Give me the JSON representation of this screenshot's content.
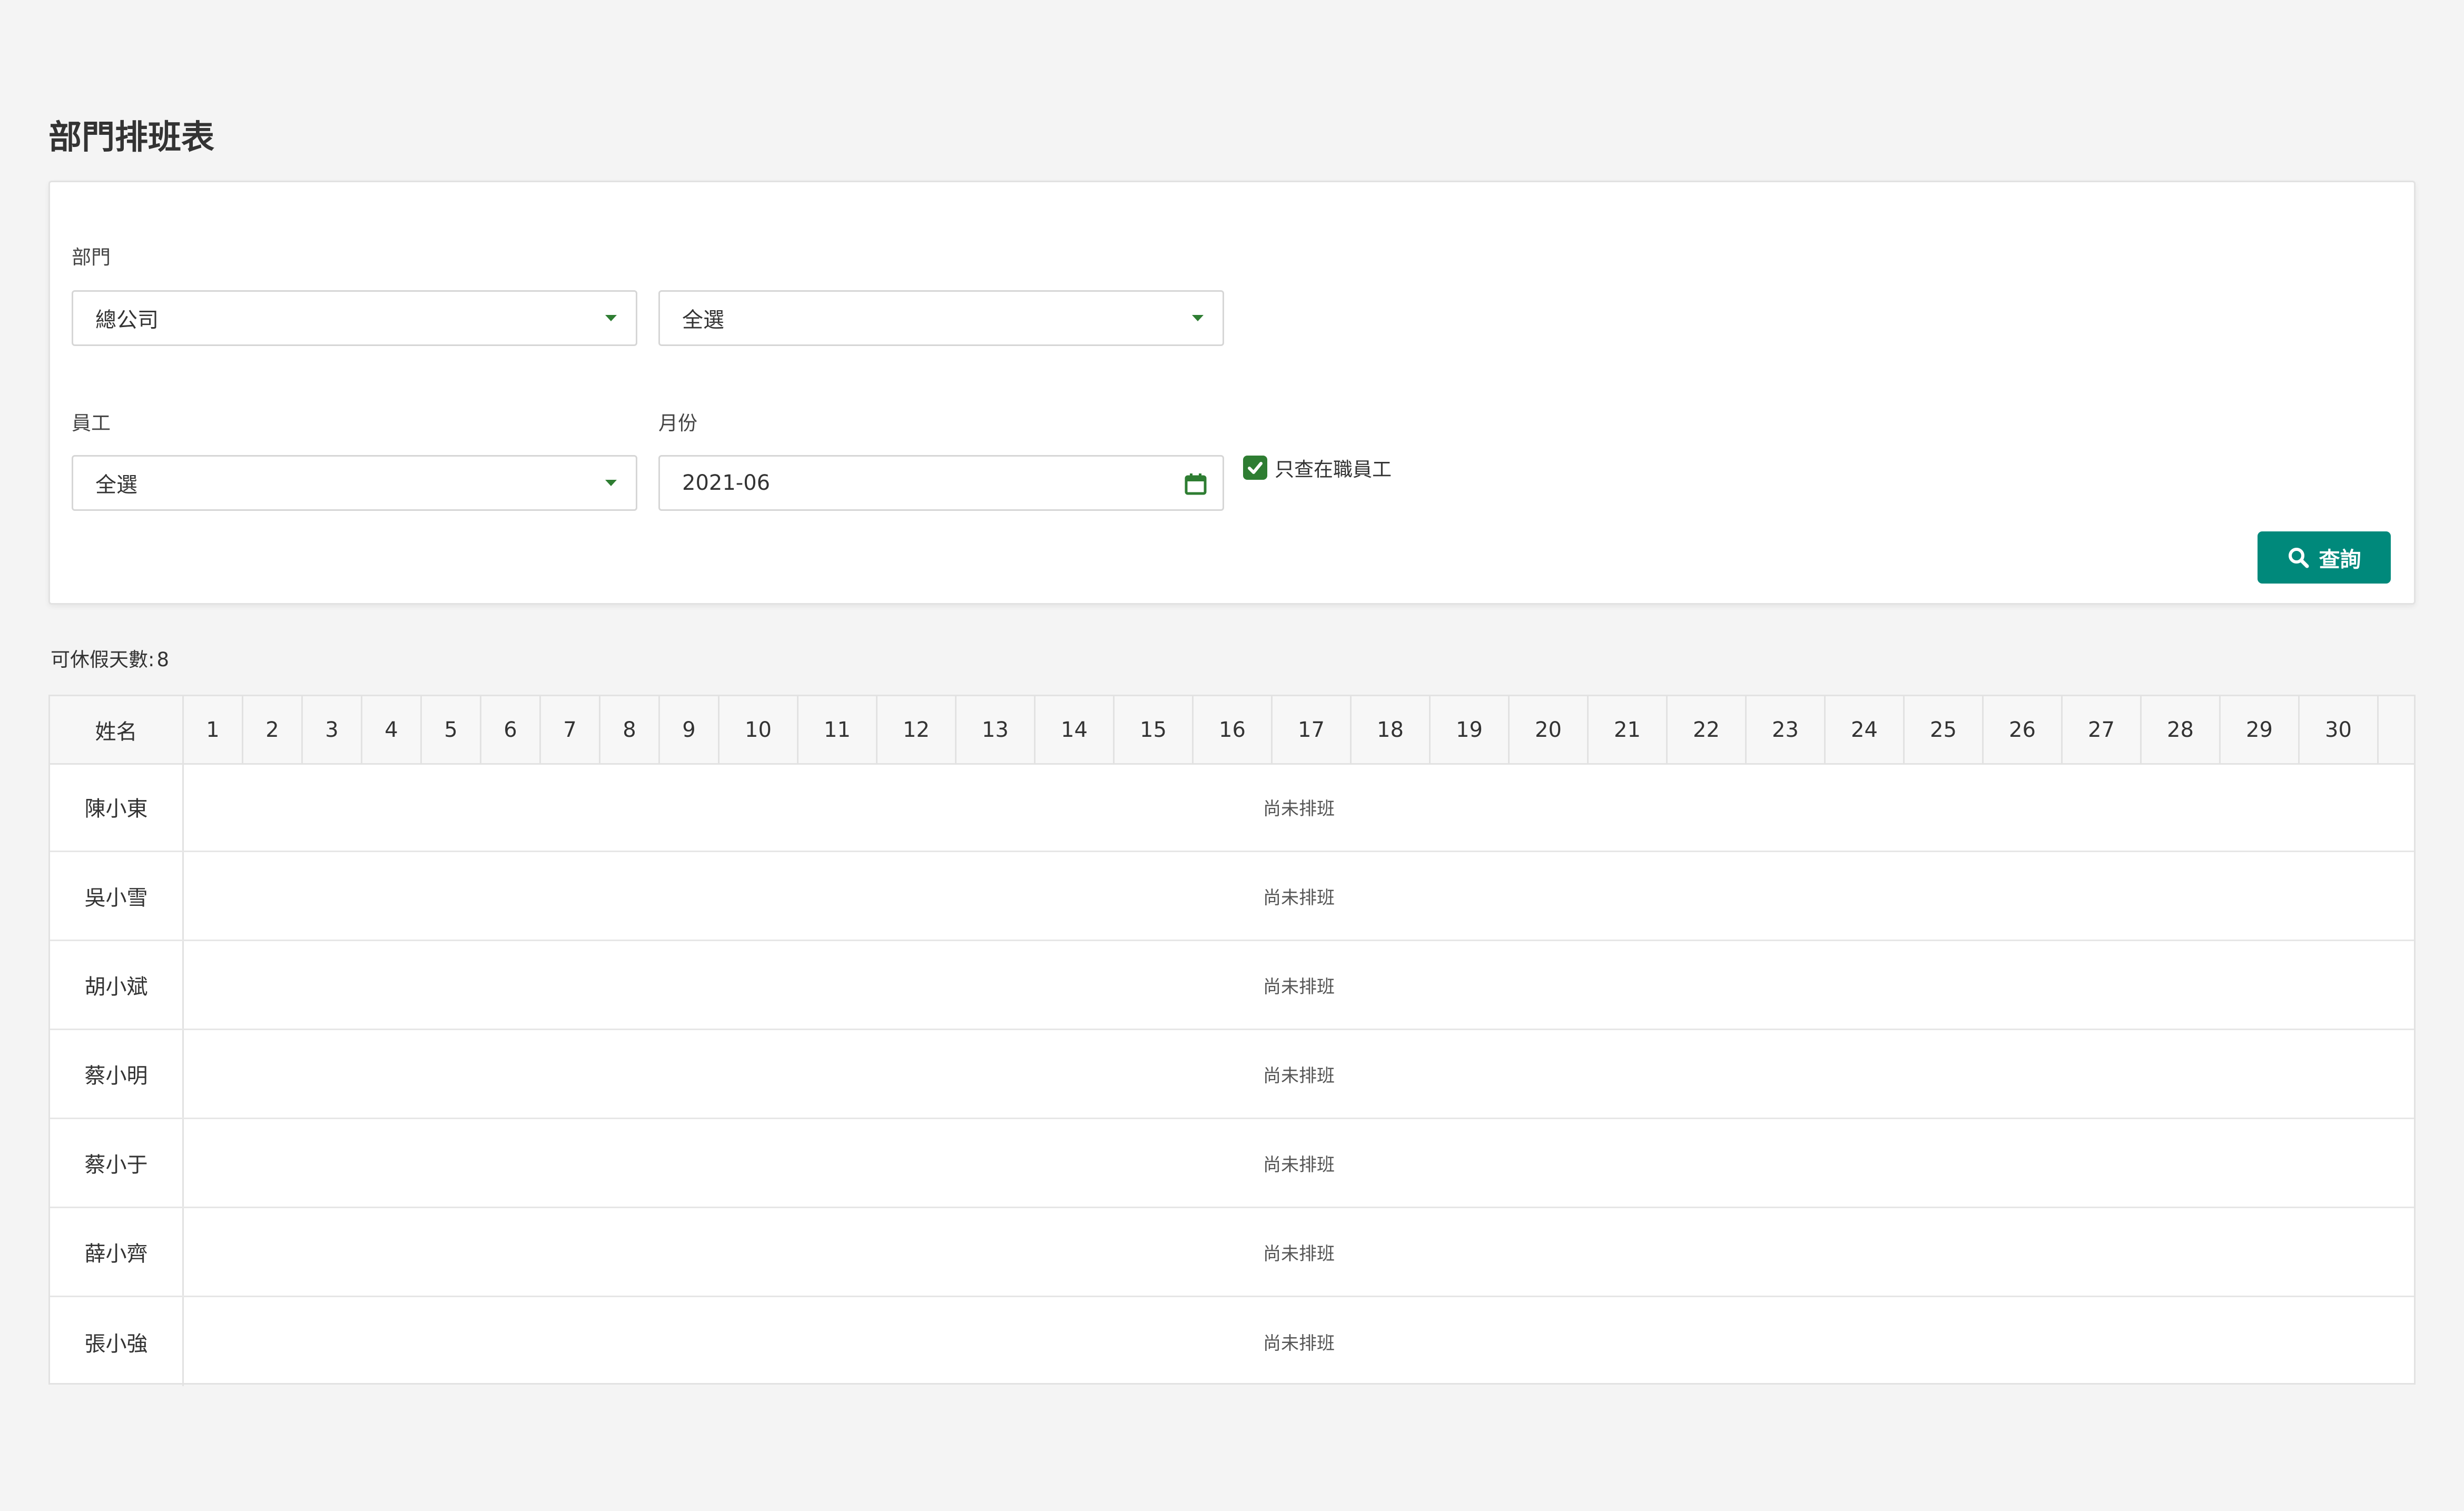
{
  "page": {
    "title": "部門排班表"
  },
  "filters": {
    "department_label": "部門",
    "department_value": "總公司",
    "sub_department_value": "全選",
    "employee_label": "員工",
    "employee_value": "全選",
    "month_label": "月份",
    "month_value": "2021-06",
    "active_only_label": "只查在職員工",
    "active_only_checked": true,
    "query_button": "查詢"
  },
  "summary": {
    "leave_days_label": "可休假天數:",
    "leave_days_value": "8"
  },
  "schedule": {
    "name_header": "姓名",
    "days": [
      "1",
      "2",
      "3",
      "4",
      "5",
      "6",
      "7",
      "8",
      "9",
      "10",
      "11",
      "12",
      "13",
      "14",
      "15",
      "16",
      "17",
      "18",
      "19",
      "20",
      "21",
      "22",
      "23",
      "24",
      "25",
      "26",
      "27",
      "28",
      "29",
      "30"
    ],
    "rows": [
      {
        "name": "陳小東",
        "status": "尚未排班"
      },
      {
        "name": "吳小雪",
        "status": "尚未排班"
      },
      {
        "name": "胡小斌",
        "status": "尚未排班"
      },
      {
        "name": "蔡小明",
        "status": "尚未排班"
      },
      {
        "name": "蔡小于",
        "status": "尚未排班"
      },
      {
        "name": "薛小齊",
        "status": "尚未排班"
      },
      {
        "name": "張小強",
        "status": "尚未排班"
      }
    ]
  },
  "colors": {
    "accent_green": "#2e7d32",
    "button_teal": "#00897b"
  }
}
